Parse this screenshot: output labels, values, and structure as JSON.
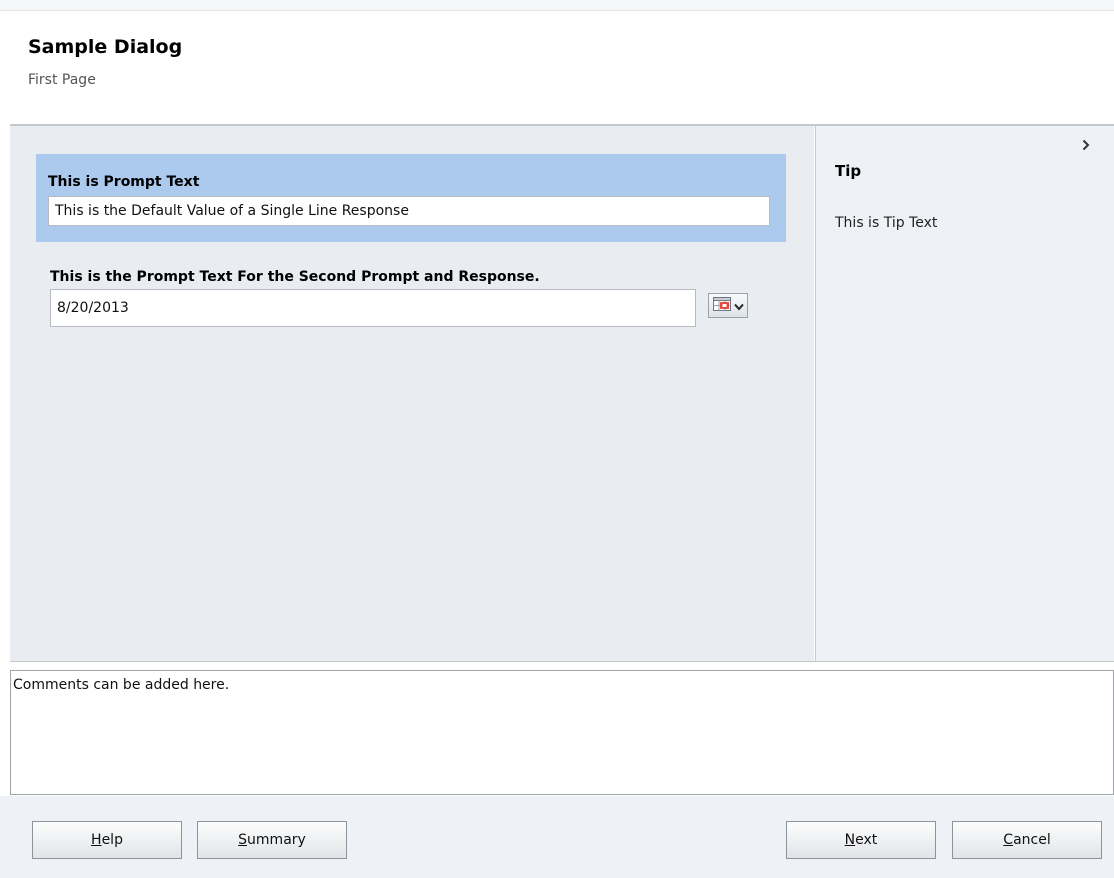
{
  "dialog": {
    "title": "Sample Dialog",
    "subtitle": "First Page"
  },
  "prompt1": {
    "label": "This is Prompt Text",
    "value": "This is the Default Value of a Single Line Response"
  },
  "prompt2": {
    "label": "This is the Prompt Text For the Second Prompt and Response.",
    "value": "8/20/2013",
    "picker_icon": "calendar-icon"
  },
  "tip": {
    "title": "Tip",
    "text": "This is Tip Text",
    "collapse_icon": "chevron-right-icon"
  },
  "comments": {
    "value": "Comments can be added here."
  },
  "buttons": {
    "help": {
      "mnemonic": "H",
      "rest": "elp"
    },
    "summary": {
      "mnemonic": "S",
      "rest": "ummary"
    },
    "next": {
      "mnemonic": "N",
      "rest": "ext"
    },
    "cancel": {
      "mnemonic": "C",
      "rest": "ancel"
    }
  },
  "colors": {
    "highlight": "#abcaed",
    "panel": "#e9ecf1"
  }
}
